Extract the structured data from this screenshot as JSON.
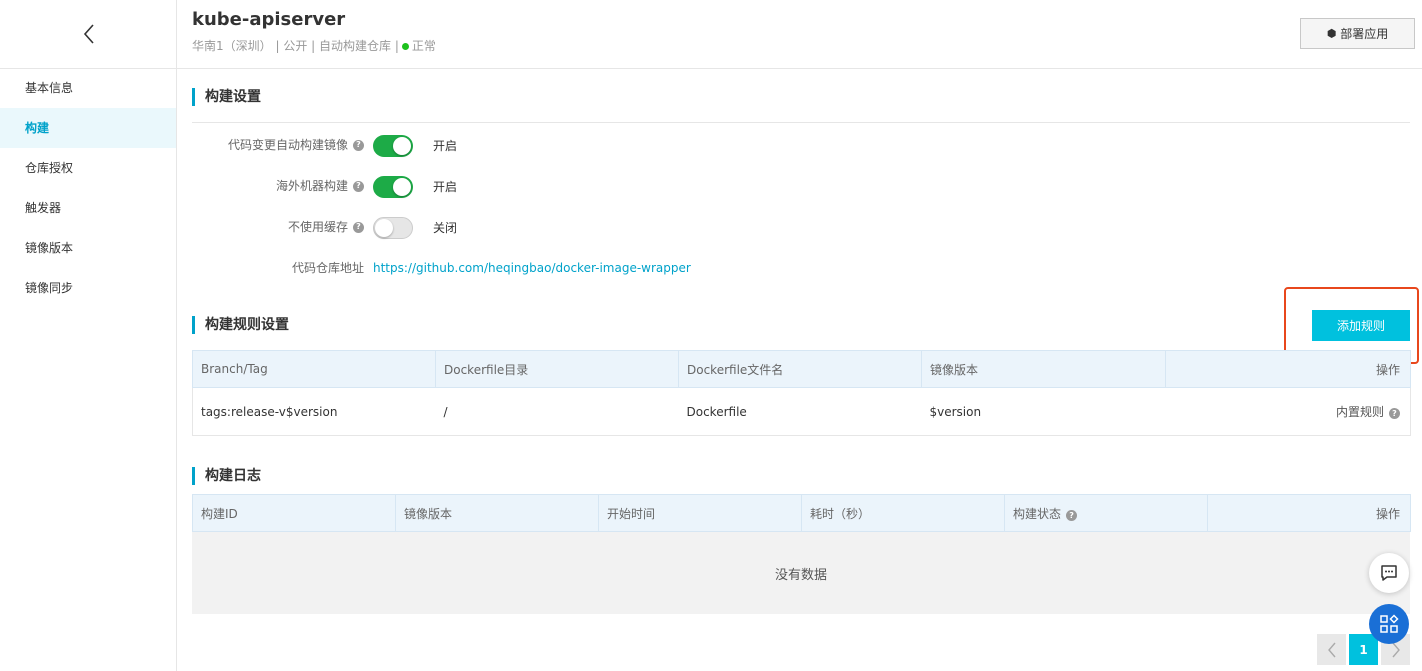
{
  "sidebar": {
    "items": [
      {
        "label": "基本信息",
        "active": false
      },
      {
        "label": "构建",
        "active": true
      },
      {
        "label": "仓库授权",
        "active": false
      },
      {
        "label": "触发器",
        "active": false
      },
      {
        "label": "镜像版本",
        "active": false
      },
      {
        "label": "镜像同步",
        "active": false
      }
    ]
  },
  "header": {
    "title": "kube-apiserver",
    "region": "华南1（深圳）",
    "visibility": "公开",
    "repo_type": "自动构建仓库",
    "status": "正常",
    "status_color": "#1dc11d",
    "deploy_label": "部署应用"
  },
  "build_settings": {
    "title": "构建设置",
    "auto_build": {
      "label": "代码变更自动构建镜像",
      "state_text": "开启",
      "enabled": true
    },
    "overseas_build": {
      "label": "海外机器构建",
      "state_text": "开启",
      "enabled": true
    },
    "no_cache": {
      "label": "不使用缓存",
      "state_text": "关闭",
      "enabled": false
    },
    "repo_address": {
      "label": "代码仓库地址",
      "url": "https://github.com/heqingbao/docker-image-wrapper"
    }
  },
  "rules": {
    "title": "构建规则设置",
    "add_label": "添加规则",
    "columns": [
      "Branch/Tag",
      "Dockerfile目录",
      "Dockerfile文件名",
      "镜像版本",
      "操作"
    ],
    "rows": [
      {
        "branch_tag": "tags:release-v$version",
        "dockerfile_dir": "/",
        "dockerfile_name": "Dockerfile",
        "image_version": "$version",
        "action": "内置规则"
      }
    ]
  },
  "logs": {
    "title": "构建日志",
    "columns": [
      "构建ID",
      "镜像版本",
      "开始时间",
      "耗时（秒）",
      "构建状态",
      "操作"
    ],
    "empty_text": "没有数据"
  },
  "pager": {
    "current": "1"
  },
  "colors": {
    "accent": "#00a2ca",
    "button": "#00c1de",
    "highlight_border": "#e8471c",
    "toggle_on": "#1dab47"
  }
}
